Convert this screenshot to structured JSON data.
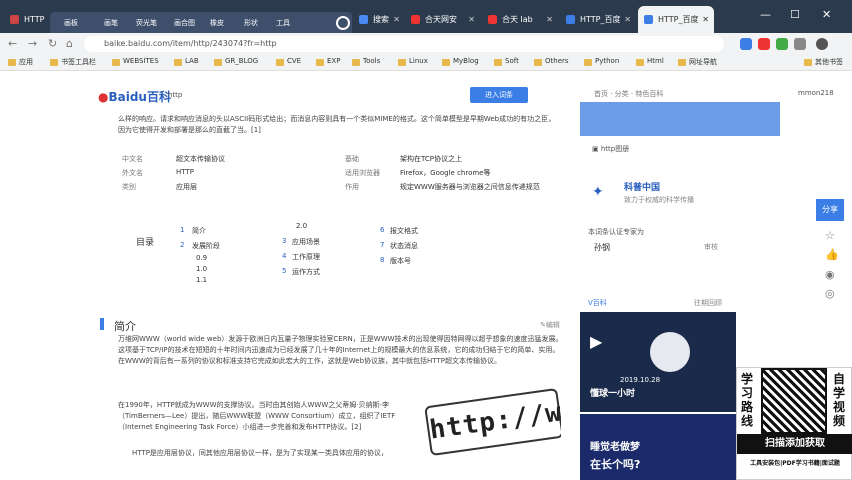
{
  "tabs": [
    {
      "label": "HTTP"
    },
    {
      "label": "搜索"
    },
    {
      "label": "合天网安"
    },
    {
      "label": "合天 lab"
    },
    {
      "label": "HTTP_百度"
    },
    {
      "label": "HTTP_百度"
    }
  ],
  "overlay_menu": [
    "画板",
    "画笔",
    "荧光笔",
    "画合图",
    "橡皮",
    "形状",
    "工具"
  ],
  "address_bar": {
    "url": "baike.baidu.com/item/http/243074?fr=http"
  },
  "bookmarks": [
    "应用",
    "书签工具栏",
    "WEBSITES",
    "LAB",
    "GR_BLOG",
    "CVE",
    "EXP",
    "Tools",
    "Linux",
    "MyBlog",
    "Soft",
    "Others",
    "Python",
    "Html",
    "网址导航",
    "其他书签"
  ],
  "header": {
    "logo_text": "Baidu百科",
    "search_word": "http",
    "enter_button": "进入词条",
    "nav_left": "首页 · 分类 · 特色百科",
    "user_name": "mmon218"
  },
  "intro_paragraph": "么样的响应。请求和响应消息的头以ASCII码形式给出；而消息内容则具有一个类似MIME的格式。这个简单模型是早期Web成功的有功之臣，因为它使得开发和部署是那么的直截了当。[1]",
  "infobox": {
    "left": [
      {
        "label": "中文名",
        "value": "超文本传输协议"
      },
      {
        "label": "外文名",
        "value": "HTTP"
      },
      {
        "label": "类别",
        "value": "应用层"
      }
    ],
    "right": [
      {
        "label": "基础",
        "value": "架构在TCP协议之上"
      },
      {
        "label": "适用浏览器",
        "value": "Firefox，Google chrome等"
      },
      {
        "label": "作用",
        "value": "规定WWW服务器与浏览器之间信息传递规范"
      }
    ]
  },
  "toc": {
    "title": "目录",
    "col1": [
      {
        "n": "1",
        "t": "简介"
      },
      {
        "n": "2",
        "t": "发展阶段"
      },
      {
        "n": "",
        "t": "0.9"
      },
      {
        "n": "",
        "t": "1.0"
      },
      {
        "n": "",
        "t": "1.1"
      }
    ],
    "col2": [
      {
        "n": "",
        "t": "2.0"
      },
      {
        "n": "3",
        "t": "应用场景"
      },
      {
        "n": "4",
        "t": "工作原理"
      },
      {
        "n": "5",
        "t": "运作方式"
      }
    ],
    "col3": [
      {
        "n": "6",
        "t": "报文格式"
      },
      {
        "n": "7",
        "t": "状态消息"
      },
      {
        "n": "8",
        "t": "版本号"
      }
    ]
  },
  "section": {
    "title": "简介",
    "edit_label": "编辑",
    "p1": "万维网WWW（world wide web）发源于欧洲日内瓦量子物理实验室CERN，正是WWW技术的出现使得因特网得以超乎想象的速度迅猛发展。这项基于TCP/IP的技术在短短的十年时间内迅速成为已经发展了几十年的Internet上的规模最大的信息系统，它的成功归结于它的简单、实用。在WWW的背后有一系列的协议和标准支持它完成如此宏大的工作，这就是Web协议族，其中就包括HTTP超文本传输协议。",
    "p2": "在1990年，HTTP就成为WWW的支撑协议。当时由其创始人WWW之父蒂姆·贝纳斯-李（TimBerners—Lee）提出，随后WWW联盟（WWW Consortium）成立，组织了IETF（Internet Engineering Task Force）小组进一步完善和发布HTTP协议。[2]",
    "p3": "HTTP是应用层协议，同其他应用层协议一样，是为了实现某一类具体应用的协议，"
  },
  "image_text": "http://www.",
  "right_column": {
    "image_caption": "http图册",
    "kepu_title": "科普中国",
    "kepu_sub": "致力于权威的科学传播",
    "certify_title": "本词条认证专家为",
    "expert_name": "孙钢",
    "expert_role": "审核",
    "v_label": "V百科",
    "v_more": "往期回顾",
    "v_text": "懂球一小时",
    "v_date": "2019.10.28",
    "card2_text1": "睡觉老做梦",
    "card2_text2": "在长个吗?"
  },
  "sidebar": {
    "share": "分享",
    "icons": [
      "star-icon",
      "like-icon",
      "weibo-icon",
      "wechat-icon",
      "qq-icon"
    ]
  },
  "ad": {
    "left_text": "学习路线",
    "right_text": "自学视频",
    "bar_text": "扫描添加获取",
    "footer_text": "工具安装包|PDF学习书籍|面试题"
  }
}
